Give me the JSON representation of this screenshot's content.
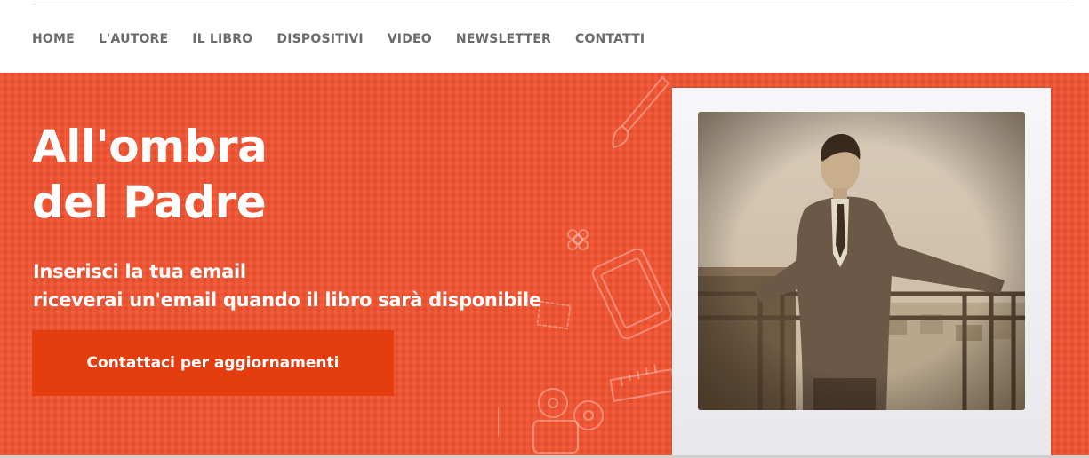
{
  "nav": {
    "items": [
      "HOME",
      "L'AUTORE",
      "IL LIBRO",
      "DISPOSITIVI",
      "VIDEO",
      "NEWSLETTER",
      "CONTATTI"
    ]
  },
  "hero": {
    "title_line1": "All'ombra",
    "title_line2": "del Padre",
    "subtitle_line1": "Inserisci la tua email",
    "subtitle_line2": "riceverai un'email quando il libro sarà disponibile",
    "cta_label": "Contattaci per aggiornamenti"
  },
  "colors": {
    "hero_background": "#f2532f",
    "cta_background": "#e43d10",
    "nav_text": "#6b6b6b",
    "hero_text": "#ffffff"
  },
  "icons": [
    "paintbrush-icon",
    "tablet-icon",
    "smartphone-icon",
    "ruler-icon",
    "film-projector-icon",
    "flower-icon"
  ],
  "image": {
    "description_name": "vintage-sepia-photo-man-on-balcony"
  }
}
